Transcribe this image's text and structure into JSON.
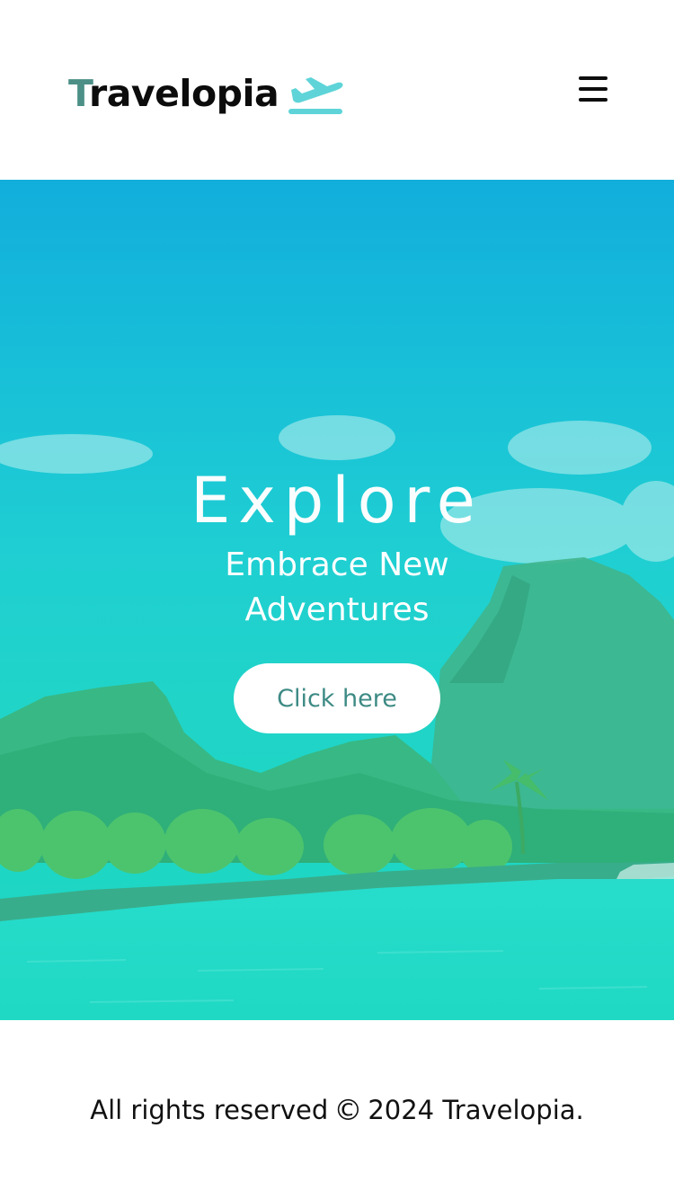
{
  "header": {
    "brand_first_letter": "T",
    "brand_rest": "ravelopia",
    "brand_icon": "airplane-takeoff-icon",
    "menu_icon": "hamburger-menu-icon"
  },
  "hero": {
    "title": "Explore",
    "subtitle": "Embrace New Adventures",
    "button_label": "Click here",
    "background": "tropical-island-lagoon-photo"
  },
  "footer": {
    "text_before": "All rights reserved",
    "copyright_symbol": "©",
    "text_after": "2024 Travelopia."
  },
  "colors": {
    "brand_accent": "#4c8f87",
    "plane_icon": "#5ed4d8",
    "hero_top": "#12aedc",
    "hero_bottom": "#1cd8c0",
    "button_text": "#3d8a84"
  }
}
